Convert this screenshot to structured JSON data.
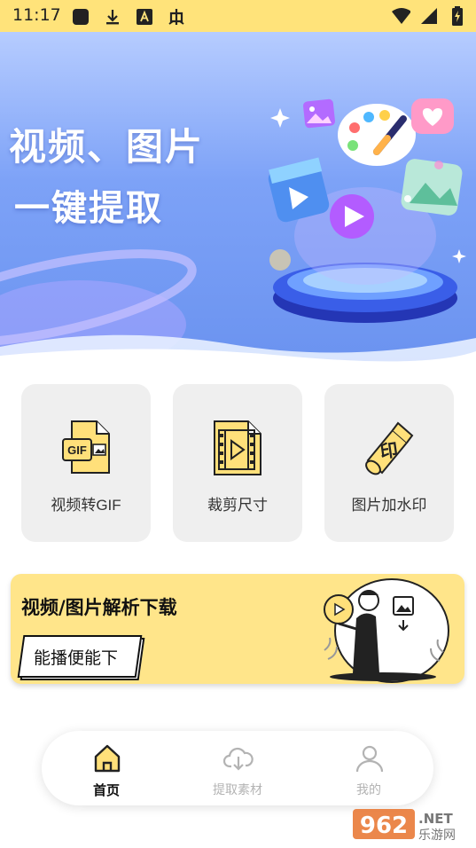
{
  "status_bar": {
    "time": "11:17",
    "left_icons": [
      "square-icon",
      "download-icon",
      "font-icon",
      "bug-icon"
    ],
    "right_icons": [
      "wifi-icon",
      "signal-icon",
      "battery-icon"
    ]
  },
  "banner": {
    "title": "视频、图片",
    "subtitle": "一键提取"
  },
  "tools": [
    {
      "label": "视频转GIF",
      "icon": "gif-file-icon",
      "badge": "GIF"
    },
    {
      "label": "裁剪尺寸",
      "icon": "video-file-icon"
    },
    {
      "label": "图片加水印",
      "icon": "stamp-icon",
      "badge": "印"
    }
  ],
  "promo": {
    "title": "视频/图片解析下载",
    "button_label": "能播便能下"
  },
  "tabbar": {
    "tabs": [
      {
        "label": "首页",
        "icon": "home-icon",
        "active": true
      },
      {
        "label": "提取素材",
        "icon": "cloud-download-icon",
        "active": false
      },
      {
        "label": "我的",
        "icon": "user-icon",
        "active": false
      }
    ]
  },
  "watermark": {
    "number": "962",
    "suffix": ".NET",
    "text": "乐游网"
  },
  "colors": {
    "accent_yellow": "#ffe37a",
    "icon_yellow": "#f7d54a",
    "card_bg": "#efefef",
    "banner_blue": "#7da2f7"
  }
}
